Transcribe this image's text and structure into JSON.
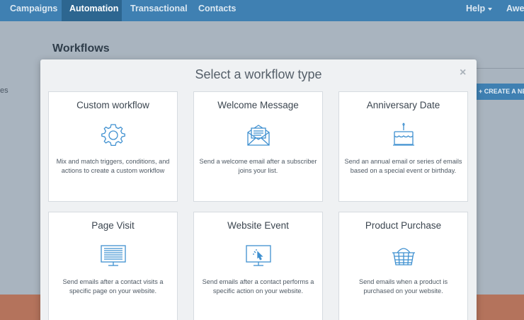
{
  "nav": {
    "items": [
      "Campaigns",
      "Automation",
      "Transactional",
      "Contacts"
    ],
    "help": "Help",
    "account": "Awe"
  },
  "background": {
    "title": "Workflows",
    "side_text": "es",
    "create_button": "+ CREATE A NEW"
  },
  "modal": {
    "title": "Select a workflow type",
    "close": "×",
    "cards": [
      {
        "title": "Custom workflow",
        "icon": "gear-icon",
        "description": "Mix and match triggers, conditions, and actions to create a custom workflow"
      },
      {
        "title": "Welcome Message",
        "icon": "envelope-icon",
        "description": "Send a welcome email after a subscriber joins your list."
      },
      {
        "title": "Anniversary Date",
        "icon": "cake-icon",
        "description": "Send an annual email or series of emails based on a special event or birthday."
      },
      {
        "title": "Page Visit",
        "icon": "webpage-monitor-icon",
        "description": "Send emails after a contact visits a specific page on your website."
      },
      {
        "title": "Website Event",
        "icon": "cursor-monitor-icon",
        "description": "Send emails after a contact performs a specific action on your website."
      },
      {
        "title": "Product Purchase",
        "icon": "shopping-basket-icon",
        "description": "Send emails when a product is purchased on your website."
      }
    ]
  },
  "colors": {
    "nav_bg": "#3f80b2",
    "nav_active": "#2d6690",
    "icon": "#3f90d0"
  }
}
